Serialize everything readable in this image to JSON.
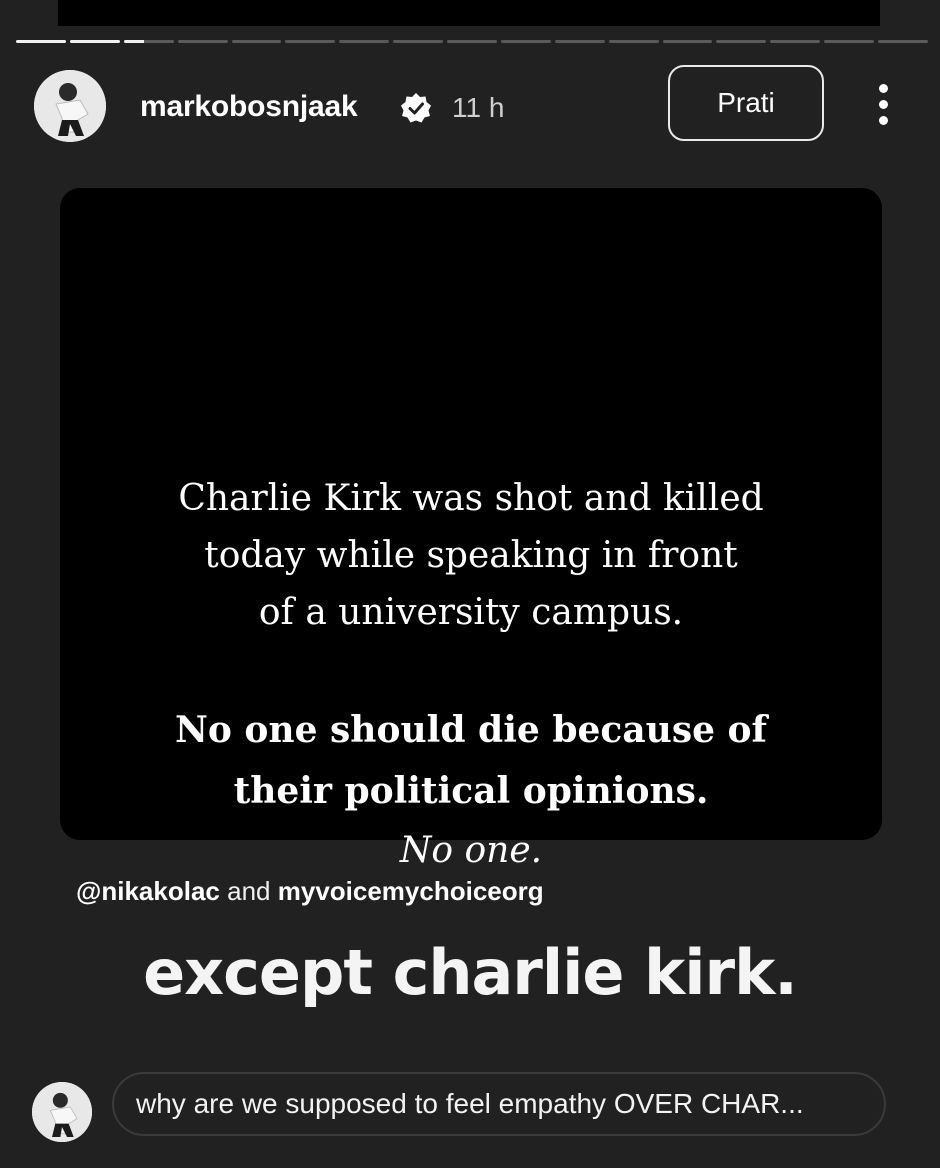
{
  "story": {
    "progress_total": 17,
    "progress_done": 2,
    "progress_current_fraction": 0.4
  },
  "header": {
    "username": "markobosnjaak",
    "time": "11 h",
    "follow_label": "Prati",
    "verified_icon": "verified-badge-icon",
    "more_icon": "more-options-icon"
  },
  "card": {
    "line1": "Charlie Kirk was shot and killed",
    "line2": "today while speaking in front",
    "line3": "of a university campus.",
    "bold1": "No one should die because of",
    "bold2": "their political opinions.",
    "italic": "No one."
  },
  "mentions": {
    "user1": "@nikakolac",
    "and": "and",
    "user2": "myvoicemychoiceorg"
  },
  "overlay_text": "except charlie kirk.",
  "reply": {
    "text": "why are we supposed to feel empathy OVER CHAR..."
  },
  "colors": {
    "background": "#212121",
    "card": "#000000",
    "text": "#ffffff"
  }
}
